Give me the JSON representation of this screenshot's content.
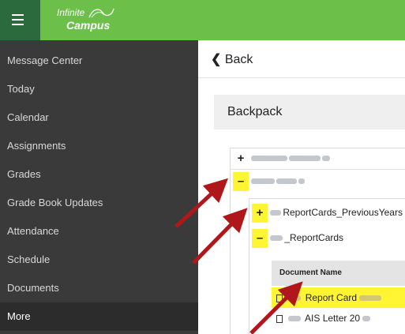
{
  "app": {
    "logo_top": "Infinite",
    "logo_bottom": "Campus",
    "colors": {
      "header": "#6cc04a",
      "menu": "#2b6a3d",
      "sidebar": "#3a3a3a",
      "highlight": "#fff533",
      "arrow": "#b0171a"
    }
  },
  "sidebar": {
    "items": [
      {
        "label": "Message Center"
      },
      {
        "label": "Today"
      },
      {
        "label": "Calendar"
      },
      {
        "label": "Assignments"
      },
      {
        "label": "Grades"
      },
      {
        "label": "Grade Book Updates"
      },
      {
        "label": "Attendance"
      },
      {
        "label": "Schedule"
      },
      {
        "label": "Documents"
      },
      {
        "label": "More"
      }
    ]
  },
  "main": {
    "back_label": "Back",
    "back_icon": "chevron-left-icon",
    "panel_title": "Backpack",
    "tree": {
      "expand_symbol": "+",
      "collapse_symbol": "–",
      "folder1_label": "ReportCards_PreviousYears",
      "folder2_label": "_ReportCards",
      "doc_header": "Document Name",
      "doc1_label": "Report Card",
      "doc2_label": "AIS Letter 20"
    }
  }
}
